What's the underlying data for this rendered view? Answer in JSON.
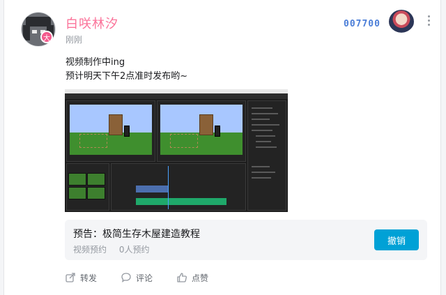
{
  "user": {
    "name": "白咲林汐",
    "timestamp": "刚刚",
    "badge": "大"
  },
  "fan_badge": {
    "number": "007700"
  },
  "post": {
    "lines": [
      "视频制作中ing",
      "预计明天下午2点准时发布哟~"
    ]
  },
  "preview": {
    "title": "预告：极简生存木屋建造教程",
    "meta_label": "视频预约",
    "meta_count": "0人预约",
    "button_label": "撤销"
  },
  "actions": {
    "share": "转发",
    "comment": "评论",
    "like": "点赞"
  },
  "colors": {
    "username": "#fb7299",
    "button": "#00a1d6",
    "fan_badge": "#4b7ed8"
  }
}
